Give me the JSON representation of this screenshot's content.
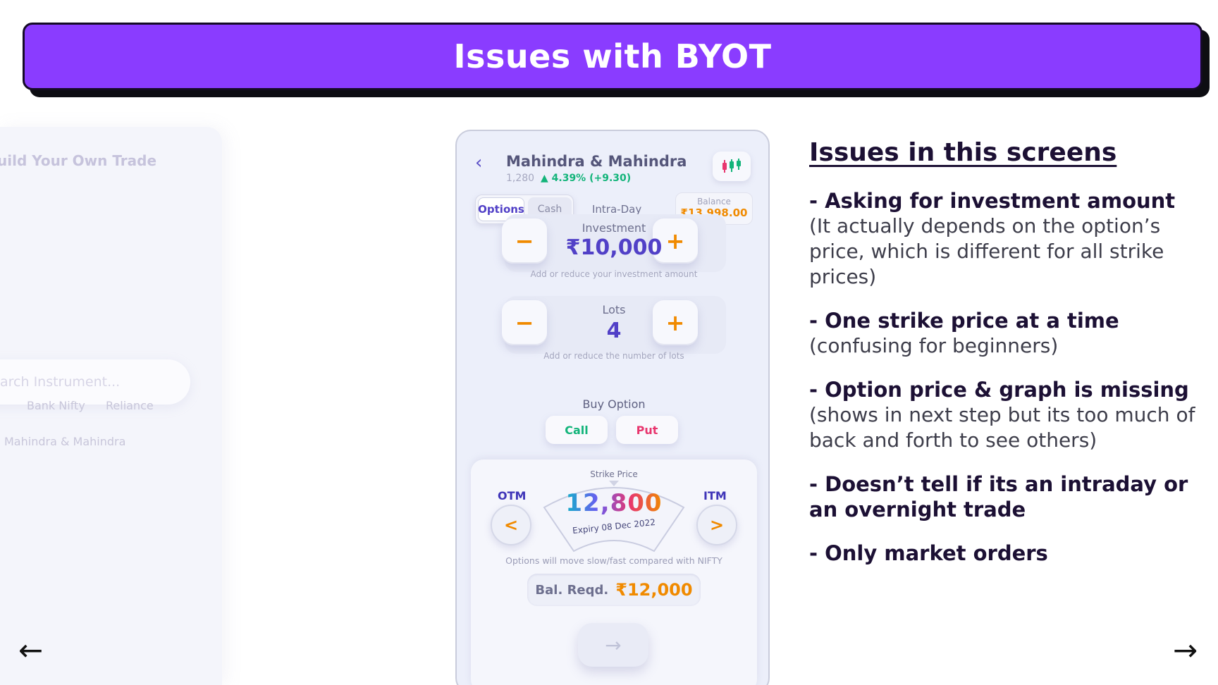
{
  "header": {
    "title": "Issues with BYOT"
  },
  "background_screen": {
    "title": "uild Your Own Trade",
    "search_placeholder": "arch Instrument...",
    "chips": [
      "Bank Nifty",
      "Reliance",
      "Mahindra & Mahindra"
    ]
  },
  "phone": {
    "stock_name": "Mahindra & Mahindra",
    "price": "1,280",
    "change": "▲ 4.39% (+9.30)",
    "tabs": {
      "options": "Options",
      "cash": "Cash",
      "intraday": "Intra-Day"
    },
    "balance": {
      "label": "Balance",
      "value": "₹13,998.00"
    },
    "investment": {
      "label": "Investment",
      "value": "₹10,000",
      "hint": "Add or reduce your investment amount",
      "minus": "−",
      "plus": "+"
    },
    "lots": {
      "label": "Lots",
      "value": "4",
      "hint": "Add or reduce the number of lots",
      "minus": "−",
      "plus": "+"
    },
    "buy_option": {
      "label": "Buy Option",
      "call": "Call",
      "put": "Put"
    },
    "strike": {
      "caption": "Strike Price",
      "otm": "OTM",
      "itm": "ITM",
      "value": "12,800",
      "expiry": "Expiry 08 Dec 2022",
      "prev": "<",
      "next": ">",
      "hint": "Options will move slow/fast compared with NIFTY"
    },
    "bal_required": {
      "label": "Bal. Reqd.",
      "value": "₹12,000"
    },
    "next_arrow": "→",
    "colors": {
      "accent": "#5140c7",
      "orange": "#f08a00",
      "green": "#13b47a",
      "pink": "#e8366e"
    }
  },
  "issues": {
    "title": "Issues in this screens",
    "items": [
      {
        "head": "- Asking for investment amount",
        "desc": "(It actually depends on the option’s price, which is different for all strike prices)"
      },
      {
        "head": "- One strike price at a time",
        "desc": "(confusing for beginners)"
      },
      {
        "head": "- Option price & graph is missing",
        "desc": "(shows in next step but its too much of back and forth to see others)"
      },
      {
        "head": "- Doesn’t tell if its an intraday or an overnight trade",
        "desc": ""
      },
      {
        "head": "- Only market orders",
        "desc": ""
      }
    ]
  },
  "navigation": {
    "prev": "←",
    "next": "→"
  },
  "banner_color": "#8a3cff"
}
